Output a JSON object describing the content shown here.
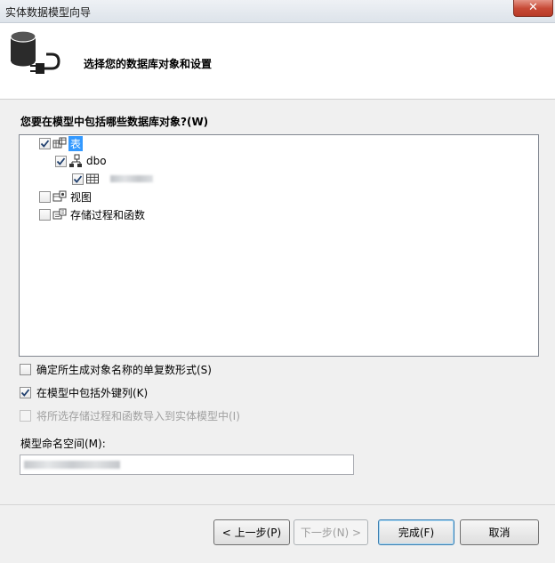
{
  "window": {
    "title": "实体数据模型向导",
    "close_glyph": "✕"
  },
  "header": {
    "title": "选择您的数据库对象和设置"
  },
  "tree_label": "您要在模型中包括哪些数据库对象?(W)",
  "tree": {
    "tables": {
      "label": "表",
      "checked": true
    },
    "dbo": {
      "label": "dbo",
      "checked": true
    },
    "table_item": {
      "label": "",
      "checked": true
    },
    "views": {
      "label": "视图",
      "checked": false
    },
    "procs": {
      "label": "存储过程和函数",
      "checked": false
    }
  },
  "options": {
    "pluralize": {
      "label": "确定所生成对象名称的单复数形式(S)",
      "checked": false,
      "enabled": true
    },
    "foreign_keys": {
      "label": "在模型中包括外键列(K)",
      "checked": true,
      "enabled": true
    },
    "import_procs": {
      "label": "将所选存储过程和函数导入到实体模型中(I)",
      "checked": false,
      "enabled": false
    }
  },
  "namespace": {
    "label": "模型命名空间(M):",
    "value": ""
  },
  "buttons": {
    "prev": "< 上一步(P)",
    "next": "下一步(N) >",
    "finish": "完成(F)",
    "cancel": "取消"
  },
  "colors": {
    "selection": "#3399ff",
    "close_button": "#c74a36"
  }
}
